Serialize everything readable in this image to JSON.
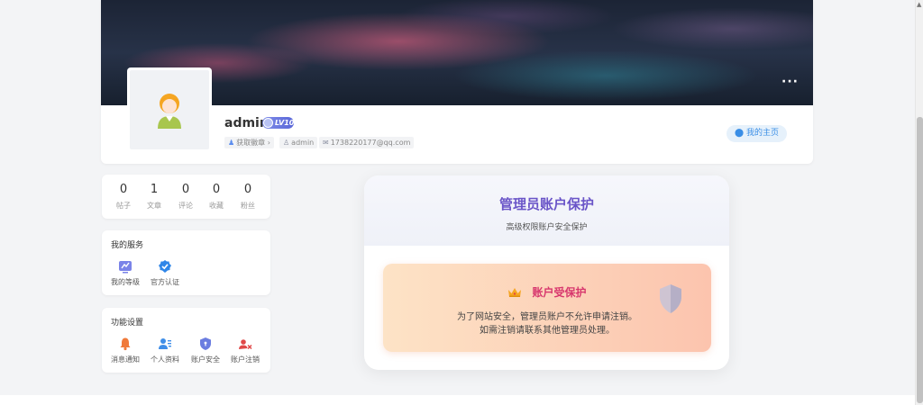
{
  "profile": {
    "username": "admin",
    "level": "LV10",
    "tags": {
      "badge": "获取徽章",
      "badge_arrow": "›",
      "account": "admin",
      "email": "1738220177@qq.com"
    },
    "home_button": "我的主页",
    "more_icon": "···"
  },
  "stats": [
    {
      "value": "0",
      "label": "帖子"
    },
    {
      "value": "1",
      "label": "文章"
    },
    {
      "value": "0",
      "label": "评论"
    },
    {
      "value": "0",
      "label": "收藏"
    },
    {
      "value": "0",
      "label": "粉丝"
    }
  ],
  "services": {
    "title": "我的服务",
    "items": [
      {
        "label": "我的等级",
        "icon": "level-chart-icon"
      },
      {
        "label": "官方认证",
        "icon": "verified-badge-icon"
      }
    ]
  },
  "settings": {
    "title": "功能设置",
    "items": [
      {
        "label": "消息通知",
        "icon": "bell-icon"
      },
      {
        "label": "个人资料",
        "icon": "user-profile-icon"
      },
      {
        "label": "账户安全",
        "icon": "shield-icon"
      },
      {
        "label": "账户注销",
        "icon": "user-remove-icon"
      }
    ]
  },
  "admin_protection": {
    "title": "管理员账户保护",
    "subtitle": "高级权限账户安全保护",
    "notice_title": "账户受保护",
    "notice_line1": "为了网站安全，管理员账户不允许申请注销。",
    "notice_line2": "如需注销请联系其他管理员处理。"
  },
  "colors": {
    "accent": "#6a55c8",
    "notice_title": "#d7366d",
    "home_button_text": "#3a8ee6",
    "level_badge": "#5a67d8"
  }
}
